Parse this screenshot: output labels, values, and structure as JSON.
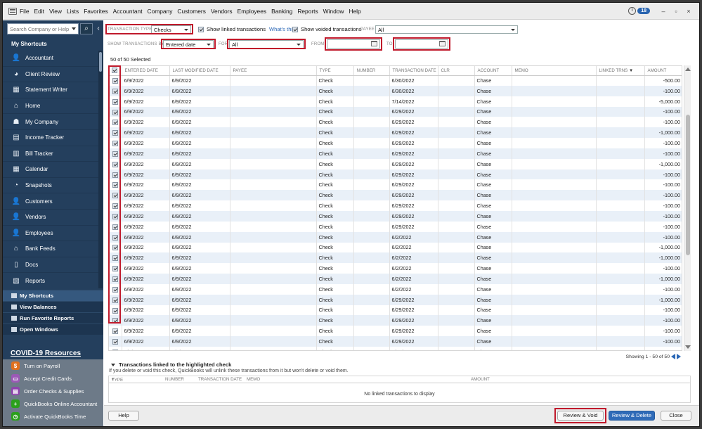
{
  "menu": [
    "File",
    "Edit",
    "View",
    "Lists",
    "Favorites",
    "Accountant",
    "Company",
    "Customers",
    "Vendors",
    "Employees",
    "Banking",
    "Reports",
    "Window",
    "Help"
  ],
  "reminders_count": "18",
  "sidebar": {
    "search_placeholder": "Search Company or Help",
    "my_shortcuts_title": "My Shortcuts",
    "items": [
      {
        "label": "Accountant",
        "icon": "accountant-icon"
      },
      {
        "label": "Client Review",
        "icon": "client-review-icon"
      },
      {
        "label": "Statement Writer",
        "icon": "statement-writer-icon"
      },
      {
        "label": "Home",
        "icon": "home-icon"
      },
      {
        "label": "My Company",
        "icon": "my-company-icon"
      },
      {
        "label": "Income Tracker",
        "icon": "income-tracker-icon"
      },
      {
        "label": "Bill Tracker",
        "icon": "bill-tracker-icon"
      },
      {
        "label": "Calendar",
        "icon": "calendar-icon"
      },
      {
        "label": "Snapshots",
        "icon": "snapshots-icon"
      },
      {
        "label": "Customers",
        "icon": "customers-icon"
      },
      {
        "label": "Vendors",
        "icon": "vendors-icon"
      },
      {
        "label": "Employees",
        "icon": "employees-icon"
      },
      {
        "label": "Bank Feeds",
        "icon": "bank-feeds-icon"
      },
      {
        "label": "Docs",
        "icon": "docs-icon"
      },
      {
        "label": "Reports",
        "icon": "reports-icon"
      }
    ],
    "nav": [
      "My Shortcuts",
      "View Balances",
      "Run Favorite Reports",
      "Open Windows"
    ],
    "covid_title": "COVID-19 Resources",
    "covid_items": [
      {
        "label": "Turn on Payroll",
        "color": "#e0701e"
      },
      {
        "label": "Accept Credit Cards",
        "color": "#9b59b6"
      },
      {
        "label": "Order Checks & Supplies",
        "color": "#8e44ad"
      },
      {
        "label": "QuickBooks Online Accountant",
        "color": "#2ca01c"
      },
      {
        "label": "Activate QuickBooks Time",
        "color": "#2ca01c"
      }
    ]
  },
  "filters": {
    "transaction_type_label": "TRANSACTION TYPE",
    "transaction_type_value": "Checks",
    "show_linked_label": "Show linked transactions",
    "whats_this": "What's this?",
    "show_voided_label": "Show voided transactions",
    "payee_label": "PAYEE",
    "payee_value": "All",
    "show_by_label": "SHOW TRANSACTIONS BY",
    "show_by_value": "Entered date",
    "for_label": "FOR",
    "for_value": "All",
    "from_label": "FROM",
    "from_value": "",
    "to_label": "TO",
    "to_value": ""
  },
  "selected_count": "50 of 50 Selected",
  "columns": [
    "",
    "ENTERED DATE",
    "LAST MODIFIED DATE",
    "PAYEE",
    "TYPE",
    "NUMBER",
    "TRANSACTION DATE",
    "CLR",
    "ACCOUNT",
    "MEMO",
    "LINKED TRNS",
    "AMOUNT"
  ],
  "rows": [
    {
      "entered": "6/9/2022",
      "modified": "6/9/2022",
      "type": "Check",
      "tdate": "6/30/2022",
      "account": "Chase",
      "amount": "-500.00"
    },
    {
      "entered": "6/9/2022",
      "modified": "6/9/2022",
      "type": "Check",
      "tdate": "6/30/2022",
      "account": "Chase",
      "amount": "-100.00"
    },
    {
      "entered": "6/9/2022",
      "modified": "6/9/2022",
      "type": "Check",
      "tdate": "7/14/2022",
      "account": "Chase",
      "amount": "-5,000.00"
    },
    {
      "entered": "6/9/2022",
      "modified": "6/9/2022",
      "type": "Check",
      "tdate": "6/29/2022",
      "account": "Chase",
      "amount": "-100.00"
    },
    {
      "entered": "6/9/2022",
      "modified": "6/9/2022",
      "type": "Check",
      "tdate": "6/29/2022",
      "account": "Chase",
      "amount": "-100.00"
    },
    {
      "entered": "6/9/2022",
      "modified": "6/9/2022",
      "type": "Check",
      "tdate": "6/29/2022",
      "account": "Chase",
      "amount": "-1,000.00"
    },
    {
      "entered": "6/9/2022",
      "modified": "6/9/2022",
      "type": "Check",
      "tdate": "6/29/2022",
      "account": "Chase",
      "amount": "-100.00"
    },
    {
      "entered": "6/9/2022",
      "modified": "6/9/2022",
      "type": "Check",
      "tdate": "6/29/2022",
      "account": "Chase",
      "amount": "-100.00"
    },
    {
      "entered": "6/9/2022",
      "modified": "6/9/2022",
      "type": "Check",
      "tdate": "6/29/2022",
      "account": "Chase",
      "amount": "-1,000.00"
    },
    {
      "entered": "6/9/2022",
      "modified": "6/9/2022",
      "type": "Check",
      "tdate": "6/29/2022",
      "account": "Chase",
      "amount": "-100.00"
    },
    {
      "entered": "6/9/2022",
      "modified": "6/9/2022",
      "type": "Check",
      "tdate": "6/29/2022",
      "account": "Chase",
      "amount": "-100.00"
    },
    {
      "entered": "6/9/2022",
      "modified": "6/9/2022",
      "type": "Check",
      "tdate": "6/29/2022",
      "account": "Chase",
      "amount": "-100.00"
    },
    {
      "entered": "6/9/2022",
      "modified": "6/9/2022",
      "type": "Check",
      "tdate": "6/29/2022",
      "account": "Chase",
      "amount": "-100.00"
    },
    {
      "entered": "6/9/2022",
      "modified": "6/9/2022",
      "type": "Check",
      "tdate": "6/29/2022",
      "account": "Chase",
      "amount": "-100.00"
    },
    {
      "entered": "6/9/2022",
      "modified": "6/9/2022",
      "type": "Check",
      "tdate": "6/29/2022",
      "account": "Chase",
      "amount": "-100.00"
    },
    {
      "entered": "6/9/2022",
      "modified": "6/9/2022",
      "type": "Check",
      "tdate": "6/2/2022",
      "account": "Chase",
      "amount": "-100.00"
    },
    {
      "entered": "6/9/2022",
      "modified": "6/9/2022",
      "type": "Check",
      "tdate": "6/2/2022",
      "account": "Chase",
      "amount": "-1,000.00"
    },
    {
      "entered": "6/9/2022",
      "modified": "6/9/2022",
      "type": "Check",
      "tdate": "6/2/2022",
      "account": "Chase",
      "amount": "-1,000.00"
    },
    {
      "entered": "6/9/2022",
      "modified": "6/9/2022",
      "type": "Check",
      "tdate": "6/2/2022",
      "account": "Chase",
      "amount": "-100.00"
    },
    {
      "entered": "6/9/2022",
      "modified": "6/9/2022",
      "type": "Check",
      "tdate": "6/2/2022",
      "account": "Chase",
      "amount": "-1,000.00"
    },
    {
      "entered": "6/9/2022",
      "modified": "6/9/2022",
      "type": "Check",
      "tdate": "6/2/2022",
      "account": "Chase",
      "amount": "-100.00"
    },
    {
      "entered": "6/9/2022",
      "modified": "6/9/2022",
      "type": "Check",
      "tdate": "6/29/2022",
      "account": "Chase",
      "amount": "-1,000.00"
    },
    {
      "entered": "6/9/2022",
      "modified": "6/9/2022",
      "type": "Check",
      "tdate": "6/29/2022",
      "account": "Chase",
      "amount": "-100.00"
    },
    {
      "entered": "6/9/2022",
      "modified": "6/9/2022",
      "type": "Check",
      "tdate": "6/29/2022",
      "account": "Chase",
      "amount": "-100.00"
    },
    {
      "entered": "6/9/2022",
      "modified": "6/9/2022",
      "type": "Check",
      "tdate": "6/29/2022",
      "account": "Chase",
      "amount": "-100.00"
    },
    {
      "entered": "6/9/2022",
      "modified": "6/9/2022",
      "type": "Check",
      "tdate": "6/29/2022",
      "account": "Chase",
      "amount": "-100.00"
    },
    {
      "entered": "6/9/2022",
      "modified": "6/9/2022",
      "type": "Check",
      "tdate": "6/30/2022",
      "account": "Chase",
      "amount": "-100.00"
    }
  ],
  "showing": "Showing 1 - 50 of 50",
  "linked": {
    "title": "Transactions linked to the highlighted check",
    "subtitle": "If you delete or void this check, QuickBooks will unlink these transactions from it but won't delete or void them.",
    "columns": [
      "TYPE",
      "NUMBER",
      "TRANSACTION DATE",
      "MEMO",
      "AMOUNT"
    ],
    "empty": "No linked transactions to display"
  },
  "buttons": {
    "help": "Help",
    "review_void": "Review & Void",
    "review_delete": "Review & Delete",
    "close": "Close"
  }
}
